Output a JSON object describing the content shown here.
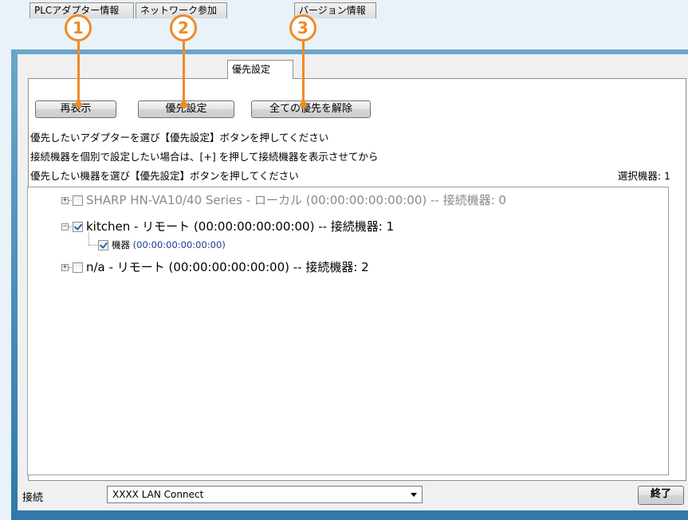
{
  "tabs": [
    {
      "label": "PLCアダプター情報",
      "active": false
    },
    {
      "label": "ネットワーク参加",
      "active": false
    },
    {
      "label": "優先設定",
      "active": true
    },
    {
      "label": "バージョン情報",
      "active": false
    }
  ],
  "buttons": {
    "refresh": "再表示",
    "priority_set": "優先設定",
    "clear_all": "全ての優先を解除"
  },
  "instructions": [
    "優先したいアダプターを選び【優先設定】ボタンを押してください",
    "接続機器を個別で設定したい場合は、[+] を押して接続機器を表示させてから",
    "優先したい機器を選び【優先設定】ボタンを押してください"
  ],
  "selected_count": "選択機器: 1",
  "tree": [
    {
      "label": "SHARP HN-VA10/40 Series - ローカル (00:00:00:00:00:00) -- 接続機器: 0",
      "checked": false,
      "expanded": false,
      "disabled": true
    },
    {
      "label": "kitchen - リモート (00:00:00:00:00:00) -- 接続機器: 1",
      "checked": true,
      "expanded": true,
      "disabled": false,
      "children": [
        {
          "label": "機器",
          "address": "(00:00:00:00:00:00)",
          "checked": true
        }
      ]
    },
    {
      "label": "n/a - リモート (00:00:00:00:00:00) -- 接続機器: 2",
      "checked": false,
      "expanded": false,
      "disabled": false
    }
  ],
  "status": {
    "connect_label": "接続",
    "connection_value": "XXXX LAN Connect",
    "exit_label": "終了"
  },
  "callouts": [
    "1",
    "2",
    "3"
  ],
  "colors": {
    "callout": "#f08a25",
    "check": "#2a5fbb",
    "disabled_text": "#8a8a8a"
  }
}
